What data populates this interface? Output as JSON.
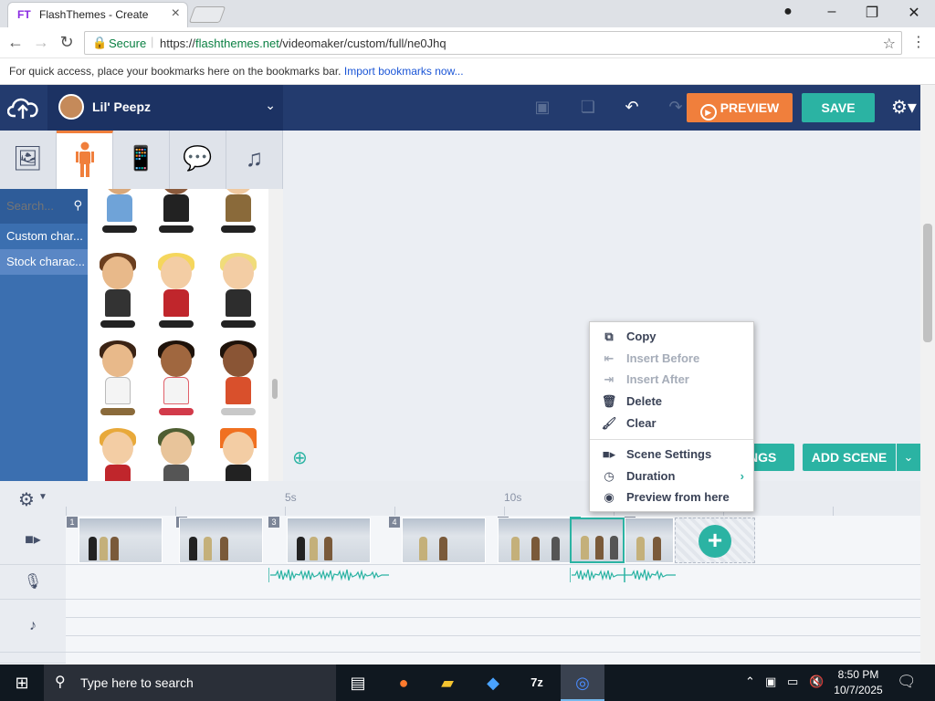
{
  "browser": {
    "tab_title": "FlashThemes - Create",
    "tab_favicon": "FT",
    "secure_label": "Secure",
    "url_prefix": "https://",
    "url_domain": "flashthemes.net",
    "url_path": "/videomaker/custom/full/ne0Jhq",
    "bookmarks_text": "For quick access, place your bookmarks here on the bookmarks bar.",
    "bookmarks_link": "Import bookmarks now..."
  },
  "header": {
    "theme_name": "Lil' Peepz",
    "preview_label": "PREVIEW",
    "save_label": "SAVE"
  },
  "asset_tabs": [
    "backgrounds-icon",
    "characters-icon",
    "props-icon",
    "text-bubble-icon",
    "music-icon"
  ],
  "sidebar": {
    "search_placeholder": "Search...",
    "categories": [
      {
        "label": "Custom char..."
      },
      {
        "label": "Stock charac..."
      }
    ]
  },
  "stage": {
    "settings_partial_label": "NGS",
    "add_scene_label": "ADD SCENE"
  },
  "context_menu": {
    "items": [
      {
        "label": "Copy",
        "icon": "copy-icon"
      },
      {
        "label": "Insert Before",
        "icon": "insert-before-icon"
      },
      {
        "label": "Insert After",
        "icon": "insert-after-icon"
      },
      {
        "label": "Delete",
        "icon": "trash-icon"
      },
      {
        "label": "Clear",
        "icon": "brush-icon"
      },
      {
        "label": "Scene Settings",
        "icon": "camera-icon"
      },
      {
        "label": "Duration",
        "icon": "clock-icon"
      },
      {
        "label": "Preview from here",
        "icon": "eye-icon"
      }
    ]
  },
  "timeline": {
    "marks": [
      "5s",
      "10s"
    ],
    "scenes": [
      {
        "num": "1"
      },
      {
        "num": "2"
      },
      {
        "num": "3"
      },
      {
        "num": "4"
      },
      {
        "num": "5"
      },
      {
        "num": "6"
      },
      {
        "num": "7"
      }
    ]
  },
  "taskbar": {
    "search_text": "Type here to search",
    "time": "8:50 PM",
    "date": "10/7/2025"
  },
  "colors": {
    "accent_orange": "#f07f3c",
    "accent_teal": "#2bb3a3",
    "header_navy": "#233b6e",
    "sidebar_blue": "#3b6fb0"
  }
}
